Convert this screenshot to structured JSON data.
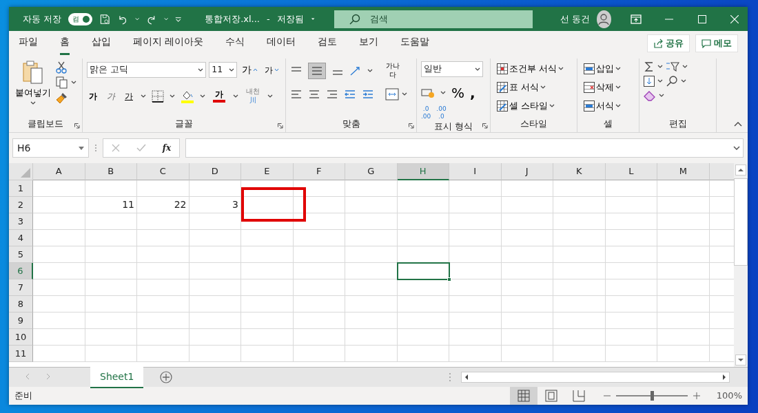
{
  "title_bar": {
    "autosave_label": "자동 저장",
    "autosave_toggle": {
      "label": "켬",
      "on": true
    },
    "file_name": "통합저장.xl...",
    "separator": "-",
    "save_status": "저장됨",
    "search": {
      "placeholder": "검색"
    },
    "user_name": "선 동건"
  },
  "menu_tabs": [
    {
      "label": "파일",
      "selected": false
    },
    {
      "label": "홈",
      "selected": true
    },
    {
      "label": "삽입",
      "selected": false
    },
    {
      "label": "페이지 레이아웃",
      "selected": false
    },
    {
      "label": "수식",
      "selected": false
    },
    {
      "label": "데이터",
      "selected": false
    },
    {
      "label": "검토",
      "selected": false
    },
    {
      "label": "보기",
      "selected": false
    },
    {
      "label": "도움말",
      "selected": false
    }
  ],
  "share_button": "공유",
  "comments_button": "메모",
  "ribbon": {
    "clipboard": {
      "paste": "붙여넣기",
      "label": "클립보드"
    },
    "font": {
      "font_name": "맑은 고딕",
      "font_size": "11",
      "grow": "가",
      "shrink": "가",
      "bold": "가",
      "italic": "가",
      "underline": "가",
      "font_color": "가",
      "phonetic": [
        "내천",
        "川"
      ],
      "label": "글꼴"
    },
    "alignment": {
      "wrap_text": [
        "가나",
        "다"
      ],
      "label": "맞춤"
    },
    "number": {
      "format": "일반",
      "percent": "%",
      "comma": ",",
      "decimal_buttons": [
        {
          "top": ".0",
          "bottom": ".00"
        },
        {
          "top": ".00",
          "bottom": ".0"
        }
      ],
      "label": "표시 형식"
    },
    "styles": {
      "items": [
        "조건부 서식",
        "표 서식",
        "셀 스타일"
      ],
      "label": "스타일"
    },
    "cells": {
      "items": [
        "삽입",
        "삭제",
        "서식"
      ],
      "label": "셀"
    },
    "editing": {
      "label": "편집"
    }
  },
  "formula_bar": {
    "name_box": "H6",
    "function_label": "fx"
  },
  "sheet": {
    "columns": [
      {
        "label": "A",
        "selected": false
      },
      {
        "label": "B",
        "selected": false
      },
      {
        "label": "C",
        "selected": false
      },
      {
        "label": "D",
        "selected": false
      },
      {
        "label": "E",
        "selected": false
      },
      {
        "label": "F",
        "selected": false
      },
      {
        "label": "G",
        "selected": false
      },
      {
        "label": "H",
        "selected": true
      },
      {
        "label": "I",
        "selected": false
      },
      {
        "label": "J",
        "selected": false
      },
      {
        "label": "K",
        "selected": false
      },
      {
        "label": "L",
        "selected": false
      },
      {
        "label": "M",
        "selected": false
      }
    ],
    "rows": [
      {
        "label": "1",
        "selected": false,
        "cells": [
          {
            "marked": false
          },
          {
            "marked": false
          },
          {
            "marked": false
          },
          {
            "marked": false
          },
          {
            "marked": false
          },
          {
            "marked": false
          },
          {
            "marked": false
          },
          {
            "marked": false
          },
          {
            "marked": false
          },
          {
            "marked": false
          },
          {
            "marked": false
          },
          {
            "marked": false
          },
          {
            "marked": false
          }
        ]
      },
      {
        "label": "2",
        "selected": false,
        "cells": [
          {
            "marked": false
          },
          {
            "text": "11",
            "marked": false
          },
          {
            "text": "22",
            "marked": false
          },
          {
            "text": "3",
            "marked": false
          },
          {
            "marked": true
          },
          {
            "marked": false
          },
          {
            "marked": false
          },
          {
            "marked": false
          },
          {
            "marked": false
          },
          {
            "marked": false
          },
          {
            "marked": false
          },
          {
            "marked": false
          },
          {
            "marked": false
          }
        ]
      },
      {
        "label": "3",
        "selected": false,
        "cells": [
          {
            "marked": false
          },
          {
            "marked": false
          },
          {
            "marked": false
          },
          {
            "marked": false
          },
          {
            "marked": false
          },
          {
            "marked": false
          },
          {
            "marked": false
          },
          {
            "marked": false
          },
          {
            "marked": false
          },
          {
            "marked": false
          },
          {
            "marked": false
          },
          {
            "marked": false
          },
          {
            "marked": false
          }
        ]
      },
      {
        "label": "4",
        "selected": false,
        "cells": [
          {
            "marked": false
          },
          {
            "marked": false
          },
          {
            "marked": false
          },
          {
            "marked": false
          },
          {
            "marked": false
          },
          {
            "marked": false
          },
          {
            "marked": false
          },
          {
            "marked": false
          },
          {
            "marked": false
          },
          {
            "marked": false
          },
          {
            "marked": false
          },
          {
            "marked": false
          },
          {
            "marked": false
          }
        ]
      },
      {
        "label": "5",
        "selected": false,
        "cells": [
          {
            "marked": false
          },
          {
            "marked": false
          },
          {
            "marked": false
          },
          {
            "marked": false
          },
          {
            "marked": false
          },
          {
            "marked": false
          },
          {
            "marked": false
          },
          {
            "marked": false
          },
          {
            "marked": false
          },
          {
            "marked": false
          },
          {
            "marked": false
          },
          {
            "marked": false
          },
          {
            "marked": false
          }
        ]
      },
      {
        "label": "6",
        "selected": true,
        "cells": [
          {
            "marked": false
          },
          {
            "marked": false
          },
          {
            "marked": false
          },
          {
            "marked": false
          },
          {
            "marked": false
          },
          {
            "marked": false
          },
          {
            "marked": false
          },
          {
            "marked": false
          },
          {
            "marked": false
          },
          {
            "marked": false
          },
          {
            "marked": false
          },
          {
            "marked": false
          },
          {
            "marked": false
          }
        ]
      },
      {
        "label": "7",
        "selected": false,
        "cells": [
          {
            "marked": false
          },
          {
            "marked": false
          },
          {
            "marked": false
          },
          {
            "marked": false
          },
          {
            "marked": false
          },
          {
            "marked": false
          },
          {
            "marked": false
          },
          {
            "marked": false
          },
          {
            "marked": false
          },
          {
            "marked": false
          },
          {
            "marked": false
          },
          {
            "marked": false
          },
          {
            "marked": false
          }
        ]
      },
      {
        "label": "8",
        "selected": false,
        "cells": [
          {
            "marked": false
          },
          {
            "marked": false
          },
          {
            "marked": false
          },
          {
            "marked": false
          },
          {
            "marked": false
          },
          {
            "marked": false
          },
          {
            "marked": false
          },
          {
            "marked": false
          },
          {
            "marked": false
          },
          {
            "marked": false
          },
          {
            "marked": false
          },
          {
            "marked": false
          },
          {
            "marked": false
          }
        ]
      },
      {
        "label": "9",
        "selected": false,
        "cells": [
          {
            "marked": false
          },
          {
            "marked": false
          },
          {
            "marked": false
          },
          {
            "marked": false
          },
          {
            "marked": false
          },
          {
            "marked": false
          },
          {
            "marked": false
          },
          {
            "marked": false
          },
          {
            "marked": false
          },
          {
            "marked": false
          },
          {
            "marked": false
          },
          {
            "marked": false
          },
          {
            "marked": false
          }
        ]
      },
      {
        "label": "10",
        "selected": false,
        "cells": [
          {
            "marked": false
          },
          {
            "marked": false
          },
          {
            "marked": false
          },
          {
            "marked": false
          },
          {
            "marked": false
          },
          {
            "marked": false
          },
          {
            "marked": false
          },
          {
            "marked": false
          },
          {
            "marked": false
          },
          {
            "marked": false
          },
          {
            "marked": false
          },
          {
            "marked": false
          },
          {
            "marked": false
          }
        ]
      },
      {
        "label": "11",
        "selected": false,
        "cells": [
          {
            "marked": false
          },
          {
            "marked": false
          },
          {
            "marked": false
          },
          {
            "marked": false
          },
          {
            "marked": false
          },
          {
            "marked": false
          },
          {
            "marked": false
          },
          {
            "marked": false
          },
          {
            "marked": false
          },
          {
            "marked": false
          },
          {
            "marked": false
          },
          {
            "marked": false
          },
          {
            "marked": false
          }
        ]
      }
    ]
  },
  "sheet_tabs": [
    {
      "label": "Sheet1",
      "selected": true
    }
  ],
  "status_bar": {
    "text": "준비",
    "views": [
      {
        "kind": "normal",
        "selected": true
      },
      {
        "kind": "layout",
        "selected": false
      },
      {
        "kind": "pagebreak",
        "selected": false
      }
    ],
    "zoom": {
      "level": 0.5,
      "reading": "100%"
    }
  }
}
